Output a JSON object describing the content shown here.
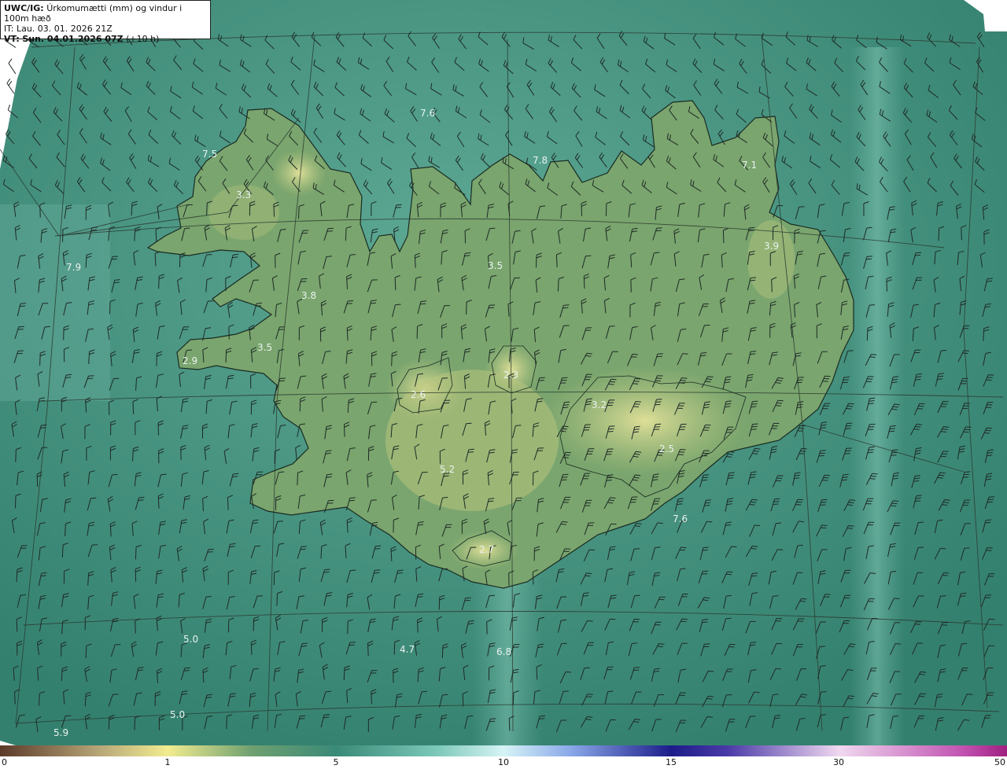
{
  "header": {
    "product": "UWC/IG:",
    "title": "Úrkomumætti (mm) og vindur i 100m hæð",
    "it_line": "IT: Lau. 03. 01. 2026 21Z",
    "vt_prefix": "VT:",
    "vt_time": "Sun. 04.01.2026 07Z",
    "vt_lead": "(+10 h)"
  },
  "colorbar": {
    "ticks": [
      "0",
      "1",
      "5",
      "10",
      "15",
      "30",
      "50"
    ],
    "stops": [
      {
        "color": "#5c3a2a",
        "value": 0
      },
      {
        "color": "#b8a878",
        "value": 0.6
      },
      {
        "color": "#f2ec90",
        "value": 1
      },
      {
        "color": "#6fa070",
        "value": 3
      },
      {
        "color": "#3a8a78",
        "value": 5
      },
      {
        "color": "#7cc8b8",
        "value": 8
      },
      {
        "color": "#d6f4f6",
        "value": 10
      },
      {
        "color": "#8aa8e8",
        "value": 12
      },
      {
        "color": "#1c1c8a",
        "value": 15
      },
      {
        "color": "#4a3aa8",
        "value": 20
      },
      {
        "color": "#f0d8f0",
        "value": 30
      },
      {
        "color": "#c050b0",
        "value": 45
      },
      {
        "color": "#a02080",
        "value": 50
      }
    ]
  },
  "map": {
    "background_color": "#3f8a78",
    "land_color": "#7ea86c",
    "highland_color": "#c6cf86",
    "value_labels": [
      "7.6",
      "7.5",
      "3.3",
      "7.9",
      "3.8",
      "3.5",
      "2.9",
      "7.8",
      "3.5",
      "7.1",
      "3.9",
      "2.3",
      "2.6",
      "5.2",
      "3.2",
      "2.5",
      "7.6",
      "2.7",
      "5.0",
      "4.7",
      "6.8",
      "5.0",
      "5.9"
    ]
  }
}
